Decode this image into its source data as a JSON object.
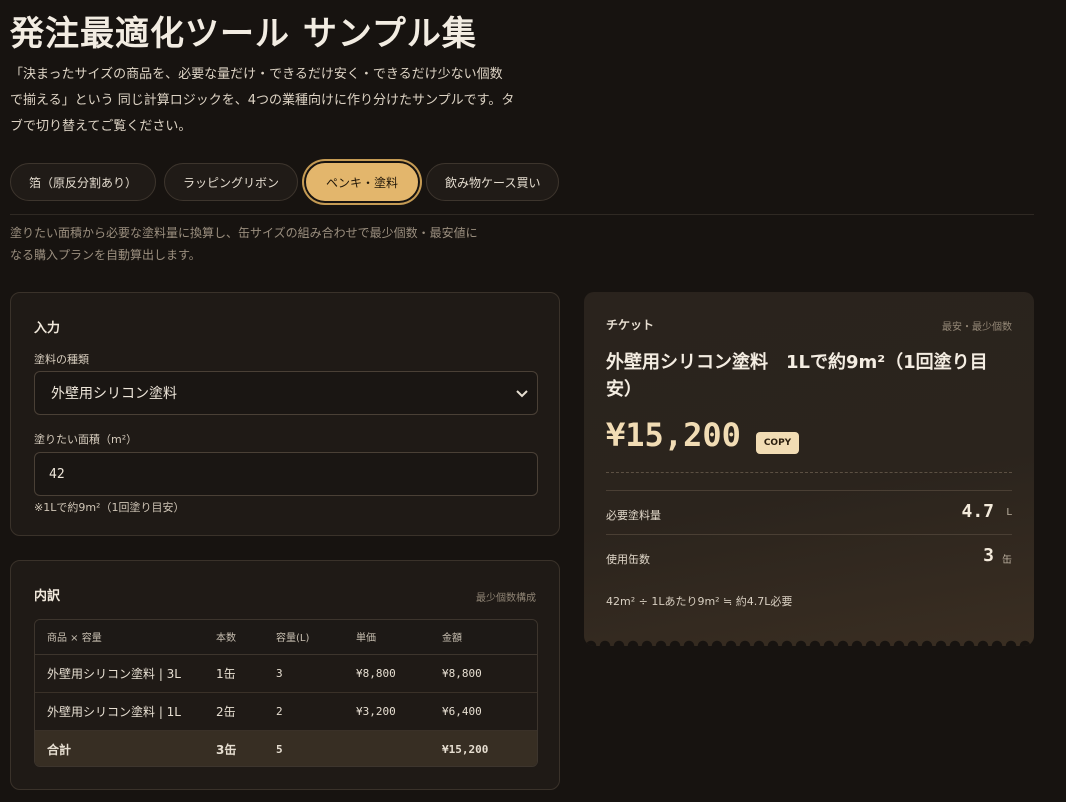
{
  "page": {
    "title": "発注最適化ツール サンプル集",
    "intro": "「決まったサイズの商品を、必要な量だけ・できるだけ安く・できるだけ少ない個数で揃える」という 同じ計算ロジックを、4つの業種向けに作り分けたサンプルです。タブで切り替えてご覧ください。"
  },
  "tabs": [
    {
      "label": "箔（原反分割あり）",
      "active": false
    },
    {
      "label": "ラッピングリボン",
      "active": false
    },
    {
      "label": "ペンキ・塗料",
      "active": true
    },
    {
      "label": "飲み物ケース買い",
      "active": false
    }
  ],
  "description": "塗りたい面積から必要な塗料量に換算し、缶サイズの組み合わせで最少個数・最安値になる購入プランを自動算出します。",
  "input_card": {
    "title": "入力",
    "type_label": "塗料の種類",
    "type_value": "外壁用シリコン塗料",
    "area_label": "塗りたい面積（m²）",
    "area_value": "42",
    "hint": "※1Lで約9m²（1回塗り目安）"
  },
  "breakdown": {
    "title": "内訳",
    "note": "最少個数構成",
    "headers": [
      "商品 × 容量",
      "本数",
      "容量(L)",
      "単価",
      "金額"
    ],
    "rows": [
      [
        "外壁用シリコン塗料 | 3L",
        "1缶",
        "3",
        "¥8,800",
        "¥8,800"
      ],
      [
        "外壁用シリコン塗料 | 1L",
        "2缶",
        "2",
        "¥3,200",
        "¥6,400"
      ]
    ],
    "total": [
      "合計",
      "3缶",
      "5",
      "",
      "¥15,200"
    ]
  },
  "ticket": {
    "label": "チケット",
    "tag": "最安・最少個数",
    "name": "外壁用シリコン塗料　1Lで約9m²（1回塗り目安）",
    "price": "¥15,200",
    "copy_label": "COPY",
    "required_label": "必要塗料量",
    "required_value": "4.7",
    "required_unit": "L",
    "cans_label": "使用缶数",
    "cans_value": "3",
    "cans_unit": "缶",
    "formula": "42m² ÷ 1Lあたり9m² ≒ 約4.7L必要"
  },
  "colors": {
    "background": "#171310",
    "accent": "#e3b66c",
    "price": "#f1dcb4"
  }
}
